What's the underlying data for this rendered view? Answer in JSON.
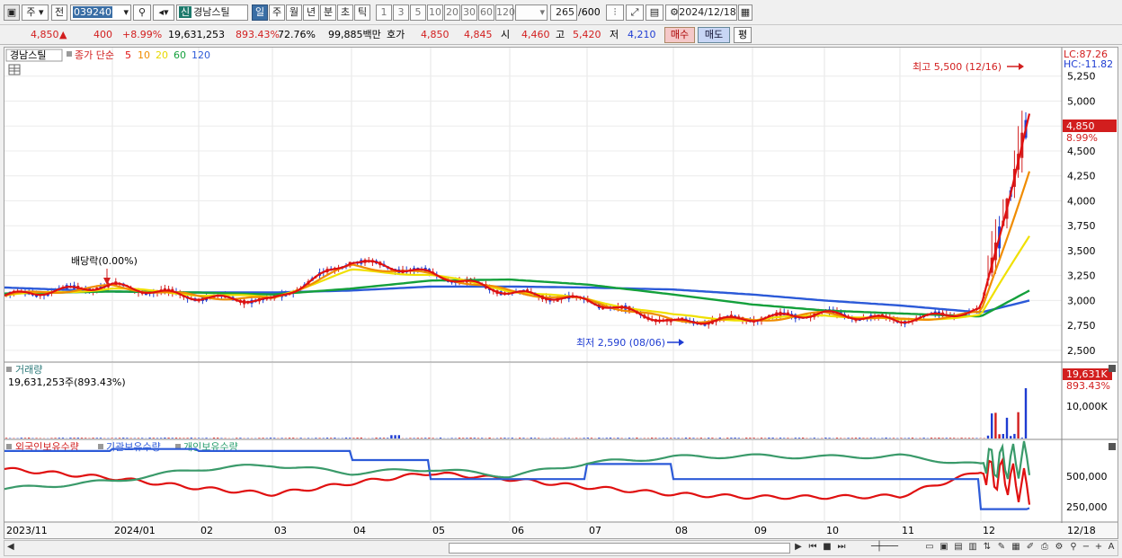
{
  "toolbar": {
    "market": "주",
    "prev": "전",
    "code": "039240",
    "name_badge": "신",
    "name": "경남스틸",
    "periods": [
      "일",
      "주",
      "월",
      "년",
      "분",
      "초",
      "틱"
    ],
    "selected_period": "일",
    "intervals": [
      "1",
      "3",
      "5",
      "10",
      "20",
      "30",
      "60",
      "120"
    ],
    "count": "265",
    "count_total": "/600",
    "date": "2024/12/18"
  },
  "quote": {
    "price": "4,850",
    "arrow": "▲",
    "change": "400",
    "change_pct": "+8.99%",
    "volume": "19,631,253",
    "vol_ratio": "893.43%",
    "turnover": "72.76%",
    "amount": "99,885백만",
    "hoga_label": "호가",
    "ask": "4,850",
    "bid": "4,845",
    "open_label": "시",
    "open": "4,460",
    "high_label": "고",
    "high": "5,420",
    "low_label": "저",
    "low": "4,210",
    "buy": "매수",
    "sell": "매도",
    "eval": "평"
  },
  "price_panel": {
    "legend_name": "경남스틸",
    "legend_ma": "종가 단순",
    "ma_periods": [
      "5",
      "10",
      "20",
      "60",
      "120"
    ],
    "lc": "LC:87.26",
    "hc": "HC:-11.82",
    "current_label": "4,850",
    "current_pct": "8.99%",
    "high_note": "최고 5,500 (12/16)",
    "low_note": "최저 2,590 (08/06)",
    "dividend_note": "배당락(0.00%)"
  },
  "volume_panel": {
    "title": "거래량",
    "info": "19,631,253주(893.43%)",
    "current_label": "19,631K",
    "current_pct": "893.43%"
  },
  "holdings_panel": {
    "foreign": "외국인보유수량",
    "institution": "기관보유수량",
    "individual": "개인보유수량"
  },
  "x_labels": [
    "2023/11",
    "2024/01",
    "02",
    "03",
    "04",
    "05",
    "06",
    "07",
    "08",
    "09",
    "10",
    "11",
    "12",
    "12/18"
  ],
  "colors": {
    "up": "#d21e1e",
    "down": "#1e3cd2",
    "ma5": "#e01010",
    "ma10": "#f08c00",
    "ma20": "#f0e000",
    "ma60": "#14a03c",
    "ma120": "#2c5ad8"
  },
  "chart_data": [
    {
      "type": "candlestick",
      "ylim": [
        2400,
        5500
      ],
      "y_ticks": [
        "5,250",
        "5,000",
        "4,750",
        "4,500",
        "4,250",
        "4,000",
        "3,750",
        "3,500",
        "3,250",
        "3,000",
        "2,750",
        "2,500"
      ],
      "x_range": [
        "2023/11",
        "2024/12/18"
      ],
      "series": [
        {
          "name": "5",
          "x": [
            "2023/11",
            "2024/01",
            "02",
            "03",
            "04",
            "05",
            "06",
            "07",
            "08",
            "09",
            "10",
            "11",
            "12",
            "12/18"
          ],
          "values": [
            3050,
            3150,
            3030,
            3000,
            3400,
            3270,
            3080,
            3000,
            2780,
            2820,
            2870,
            2800,
            2900,
            4850
          ]
        },
        {
          "name": "10",
          "x": [
            "2023/11",
            "2024/01",
            "02",
            "03",
            "04",
            "05",
            "06",
            "07",
            "08",
            "09",
            "10",
            "11",
            "12",
            "12/18"
          ],
          "values": [
            3050,
            3140,
            3040,
            3010,
            3350,
            3260,
            3090,
            3000,
            2800,
            2800,
            2870,
            2800,
            2870,
            4300
          ]
        },
        {
          "name": "20",
          "x": [
            "2023/11",
            "2024/01",
            "02",
            "03",
            "04",
            "05",
            "06",
            "07",
            "08",
            "09",
            "10",
            "11",
            "12",
            "12/18"
          ],
          "values": [
            3050,
            3120,
            3060,
            3030,
            3300,
            3260,
            3100,
            3010,
            2850,
            2800,
            2860,
            2800,
            2850,
            3650
          ]
        },
        {
          "name": "60",
          "x": [
            "2023/11",
            "2024/01",
            "02",
            "03",
            "04",
            "05",
            "06",
            "07",
            "08",
            "09",
            "10",
            "11",
            "12",
            "12/18"
          ],
          "values": [
            3070,
            3090,
            3080,
            3060,
            3120,
            3200,
            3210,
            3160,
            3060,
            2960,
            2900,
            2870,
            2840,
            3100
          ]
        },
        {
          "name": "120",
          "x": [
            "2023/11",
            "2024/01",
            "02",
            "03",
            "04",
            "05",
            "06",
            "07",
            "08",
            "09",
            "10",
            "11",
            "12",
            "12/18"
          ],
          "values": [
            3130,
            3090,
            3080,
            3080,
            3100,
            3140,
            3140,
            3130,
            3110,
            3060,
            3000,
            2950,
            2880,
            3000
          ]
        }
      ]
    },
    {
      "type": "bar",
      "title": "거래량",
      "y_ticks": [
        "10,000K"
      ],
      "ylim": [
        0,
        20000
      ],
      "categories": [
        "2023/11",
        "04",
        "12",
        "12/18"
      ],
      "values": [
        200,
        1300,
        6500,
        19631
      ]
    },
    {
      "type": "line",
      "y_ticks": [
        "500,000",
        "250,000"
      ],
      "x": [
        "2023/11",
        "2024/01",
        "02",
        "03",
        "04",
        "05",
        "06",
        "07",
        "08",
        "09",
        "10",
        "11",
        "12",
        "12/18"
      ],
      "series": [
        {
          "name": "외국인보유수량",
          "values": [
            520,
            430,
            330,
            270,
            380,
            480,
            420,
            340,
            270,
            240,
            240,
            250,
            500,
            350
          ]
        },
        {
          "name": "기관보유수량",
          "values": [
            700,
            720,
            700,
            700,
            610,
            420,
            420,
            570,
            420,
            420,
            420,
            420,
            120,
            130
          ]
        },
        {
          "name": "개인보유수량",
          "values": [
            320,
            400,
            520,
            560,
            480,
            520,
            450,
            580,
            640,
            650,
            640,
            650,
            560,
            640
          ]
        }
      ]
    }
  ]
}
